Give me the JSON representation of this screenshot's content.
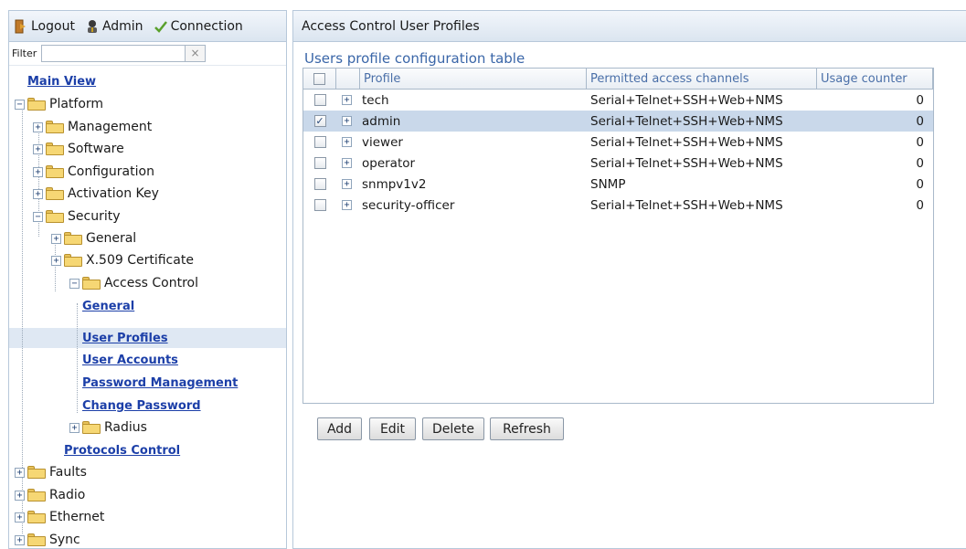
{
  "topbar": {
    "logout_label": "Logout",
    "admin_label": "Admin",
    "connection_label": "Connection"
  },
  "filter": {
    "label": "Filter",
    "value": "",
    "clear_symbol": "×"
  },
  "tree": {
    "main_view": "Main View",
    "platform": "Platform",
    "management": "Management",
    "software": "Software",
    "configuration": "Configuration",
    "activation_key": "Activation Key",
    "security": "Security",
    "general": "General",
    "x509": "X.509 Certificate",
    "access_control": "Access Control",
    "ac_general": "General",
    "user_profiles": "User Profiles",
    "user_accounts": "User Accounts",
    "password_management": "Password Management",
    "change_password": "Change Password",
    "radius": "Radius",
    "protocols_control": "Protocols Control",
    "faults": "Faults",
    "radio": "Radio",
    "ethernet": "Ethernet",
    "sync": "Sync"
  },
  "right": {
    "panel_title": "Access Control User Profiles",
    "table_title": "Users profile configuration table",
    "columns": {
      "profile": "Profile",
      "permitted": "Permitted access channels",
      "usage": "Usage counter"
    },
    "rows": [
      {
        "profile": "tech",
        "permitted": "Serial+Telnet+SSH+Web+NMS",
        "usage": "0"
      },
      {
        "profile": "admin",
        "permitted": "Serial+Telnet+SSH+Web+NMS",
        "usage": "0"
      },
      {
        "profile": "viewer",
        "permitted": "Serial+Telnet+SSH+Web+NMS",
        "usage": "0"
      },
      {
        "profile": "operator",
        "permitted": "Serial+Telnet+SSH+Web+NMS",
        "usage": "0"
      },
      {
        "profile": "snmpv1v2",
        "permitted": "SNMP",
        "usage": "0"
      },
      {
        "profile": "security-officer",
        "permitted": "Serial+Telnet+SSH+Web+NMS",
        "usage": "0"
      }
    ],
    "buttons": {
      "add": "Add",
      "edit": "Edit",
      "delete": "Delete",
      "refresh": "Refresh"
    }
  },
  "colors": {
    "link": "#1c3fa8",
    "selected_row": "#c9d8ea",
    "header_text": "#4a6fa8"
  }
}
